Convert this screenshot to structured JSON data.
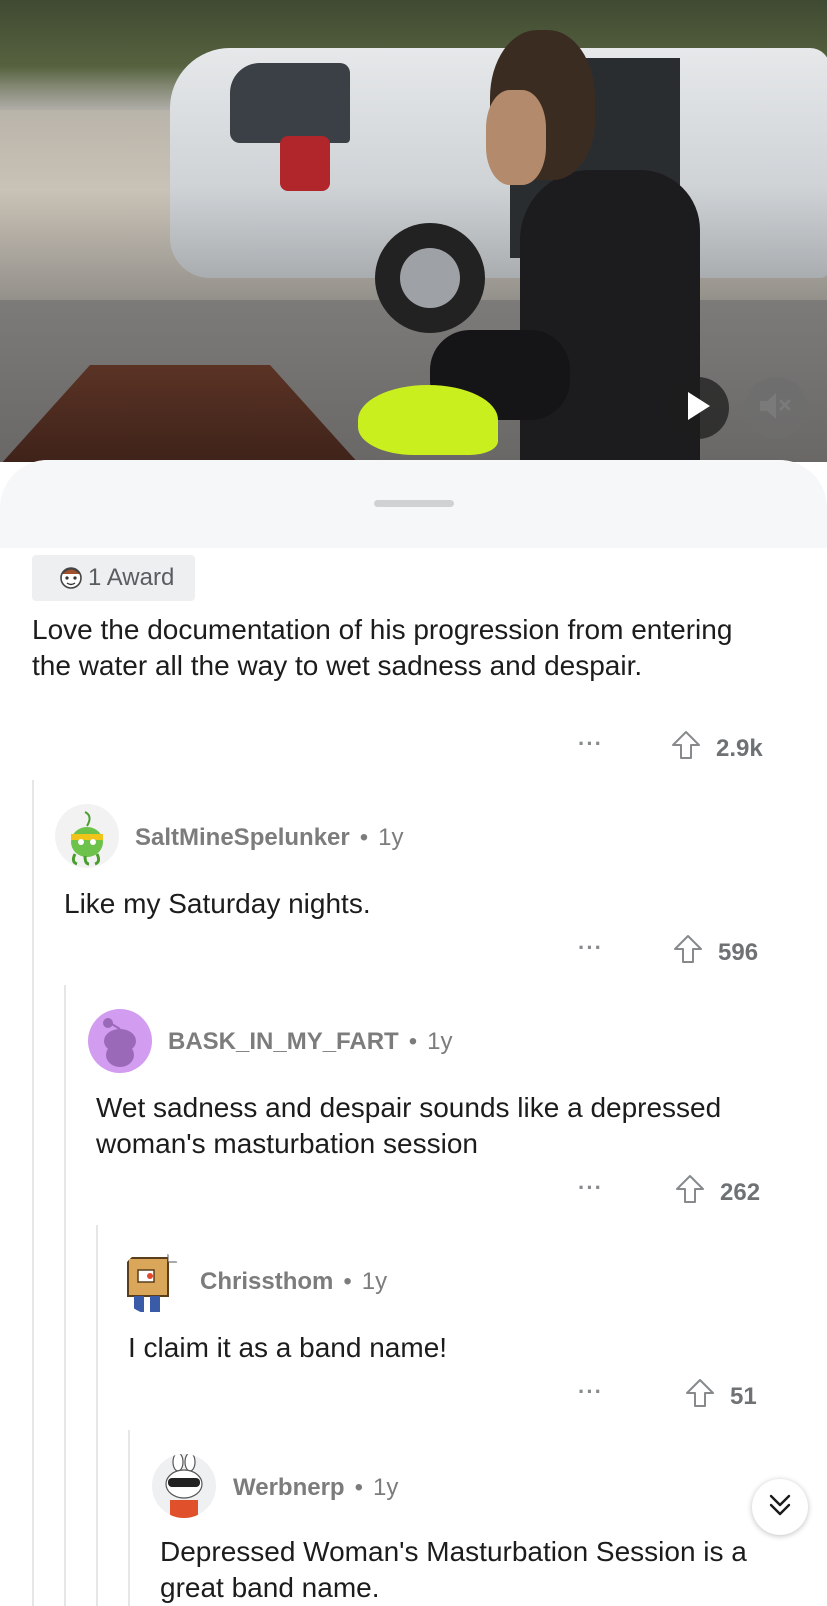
{
  "video": {
    "play_icon": "play-icon",
    "mute_icon": "speaker-muted-icon"
  },
  "post": {
    "award_label": "1 Award",
    "comment_text": "Love the documentation of his progression from entering the water all the way to wet sadness and despair.",
    "more": "···",
    "votes": "2.9k"
  },
  "comments": [
    {
      "username": "SaltMineSpelunker",
      "dot": "•",
      "age": "1y",
      "text": "Like my Saturday nights.",
      "more": "···",
      "votes": "596"
    },
    {
      "username": "BASK_IN_MY_FART",
      "dot": "•",
      "age": "1y",
      "text": "Wet sadness and despair sounds like a depressed woman's masturbation session",
      "more": "···",
      "votes": "262"
    },
    {
      "username": "Chrissthom",
      "dot": "•",
      "age": "1y",
      "text": "I claim it as a band name!",
      "more": "···",
      "votes": "51"
    },
    {
      "username": "Werbnerp",
      "dot": "•",
      "age": "1y",
      "text": "Depressed Woman's Masturbation Session is a great band name."
    }
  ],
  "colors": {
    "sheet_top": "#f6f7f8",
    "award_bg": "#edeff1",
    "thread_line": "#e4e6e8",
    "meta_gray": "#7c7c7c"
  }
}
